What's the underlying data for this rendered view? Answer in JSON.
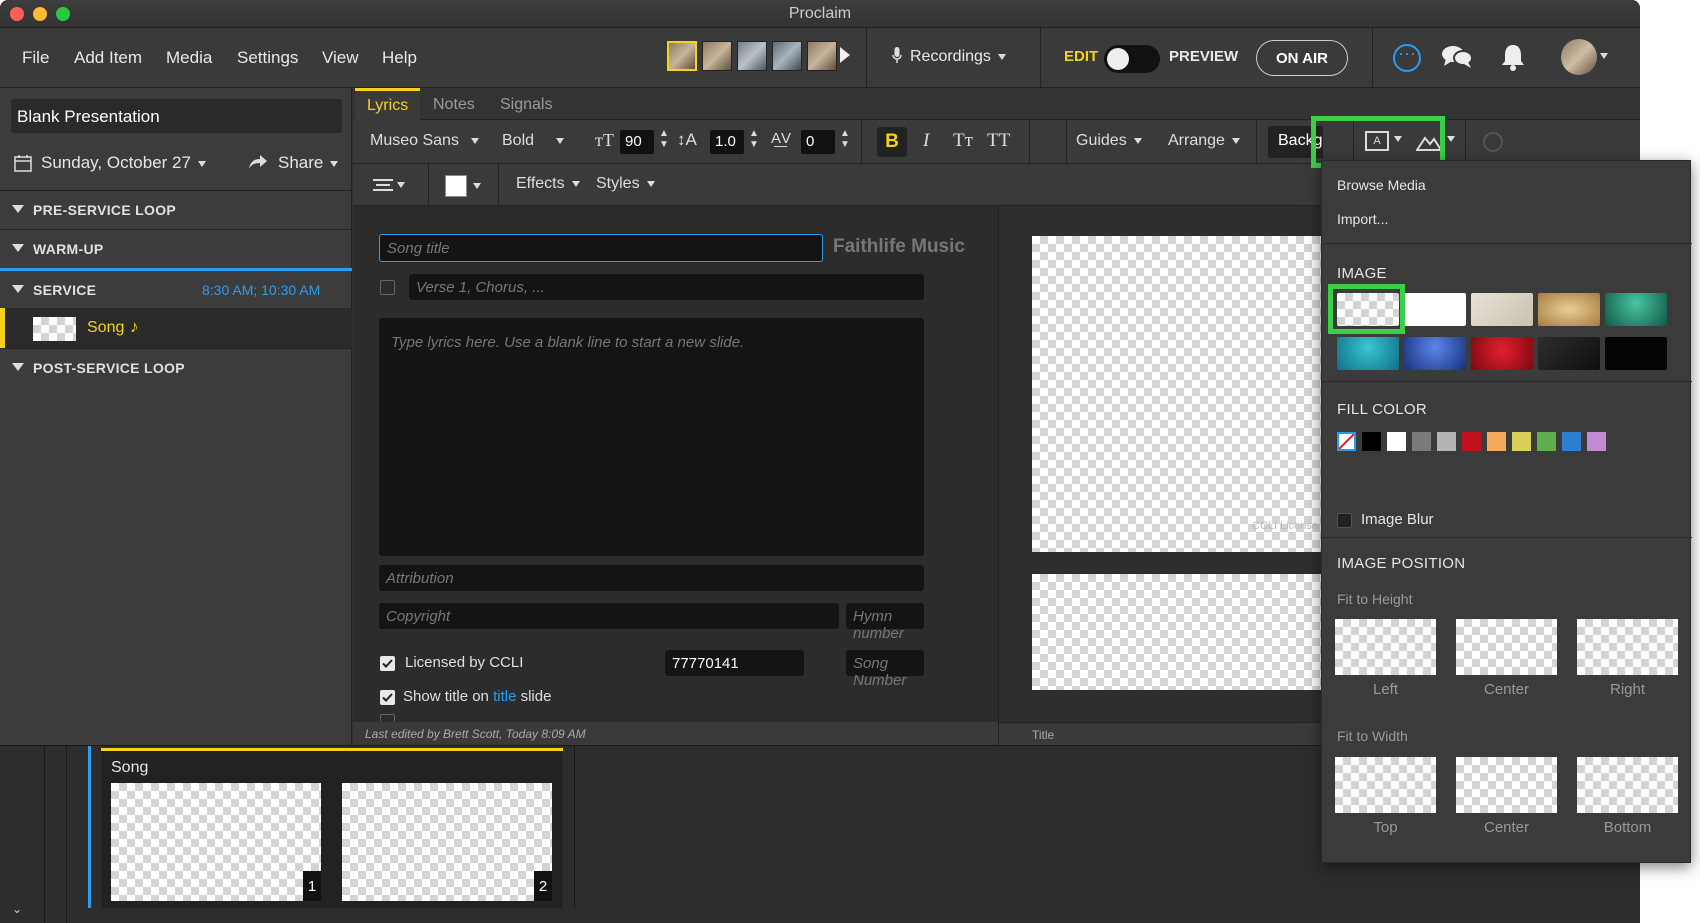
{
  "app": {
    "title": "Proclaim"
  },
  "menu": [
    "File",
    "Add Item",
    "Media",
    "Settings",
    "View",
    "Help"
  ],
  "header": {
    "recordings_label": "Recordings",
    "edit_label": "EDIT",
    "preview_label": "PREVIEW",
    "on_air_label": "ON AIR"
  },
  "sidebar": {
    "presentation_title": "Blank Presentation",
    "date": "Sunday, October 27",
    "share_label": "Share",
    "sections": [
      {
        "label": "PRE-SERVICE LOOP",
        "time": ""
      },
      {
        "label": "WARM-UP",
        "time": ""
      },
      {
        "label": "SERVICE",
        "time": "8:30 AM; 10:30 AM"
      },
      {
        "label": "POST-SERVICE LOOP",
        "time": ""
      }
    ],
    "song_item": "Song",
    "song_icon": "♪"
  },
  "tabs": [
    "Lyrics",
    "Notes",
    "Signals"
  ],
  "toolbar": {
    "font_family": "Museo Sans",
    "font_weight": "Bold",
    "font_size": "90",
    "line_height": "1.0",
    "letter_spacing": "0",
    "bold": "B",
    "italic": "I",
    "small_caps": "Tт",
    "all_caps": "TT",
    "guides": "Guides",
    "arrange": "Arrange",
    "background": "Background",
    "effects": "Effects",
    "styles": "Styles"
  },
  "editor": {
    "song_title_placeholder": "Song title",
    "faithlife_logo": "Faithlife Music",
    "verse_placeholder": "Verse 1, Chorus, ...",
    "lyrics_placeholder": "Type lyrics here. Use a blank line to start a new slide.",
    "attribution_placeholder": "Attribution",
    "copyright_placeholder": "Copyright",
    "hymn_placeholder": "Hymn number",
    "ccli_label": "Licensed by CCLI",
    "ccli_number": "77770141",
    "song_number_placeholder": "Song Number",
    "show_title_prefix": "Show title on",
    "show_title_link": "title",
    "show_title_suffix": "slide",
    "last_edited": "Last edited by Brett Scott, Today 8:09 AM"
  },
  "preview": {
    "ccli_watermark": "CCLI License",
    "title_label": "Title"
  },
  "bottom": {
    "song_label": "Song",
    "slide_numbers": [
      "1",
      "2"
    ]
  },
  "background_menu": {
    "browse_media": "Browse Media",
    "import": "Import...",
    "image_heading": "IMAGE",
    "image_swatches": [
      "transparent",
      "#ffffff",
      "#d8d2c4",
      "#c9a76a",
      "#1f9a7a",
      "#1fa7b8",
      "#2d56c8",
      "#c8101c",
      "#222222",
      "#050505"
    ],
    "fill_heading": "FILL COLOR",
    "fill_colors": [
      "none",
      "#000000",
      "#ffffff",
      "#7a7a7a",
      "#b4b4b4",
      "#c0111e",
      "#f5a95b",
      "#d9cf5d",
      "#5fae4d",
      "#2f7fd0",
      "#c48ad3"
    ],
    "image_blur": "Image Blur",
    "position_heading": "IMAGE POSITION",
    "fit_height": "Fit to Height",
    "fit_height_options": [
      "Left",
      "Center",
      "Right"
    ],
    "fit_width": "Fit to Width",
    "fit_width_options": [
      "Top",
      "Center",
      "Bottom"
    ]
  },
  "colors": {
    "accent_yellow": "#f5d21b",
    "accent_blue": "#2c9cf0",
    "highlight_green": "#3bcf45"
  }
}
